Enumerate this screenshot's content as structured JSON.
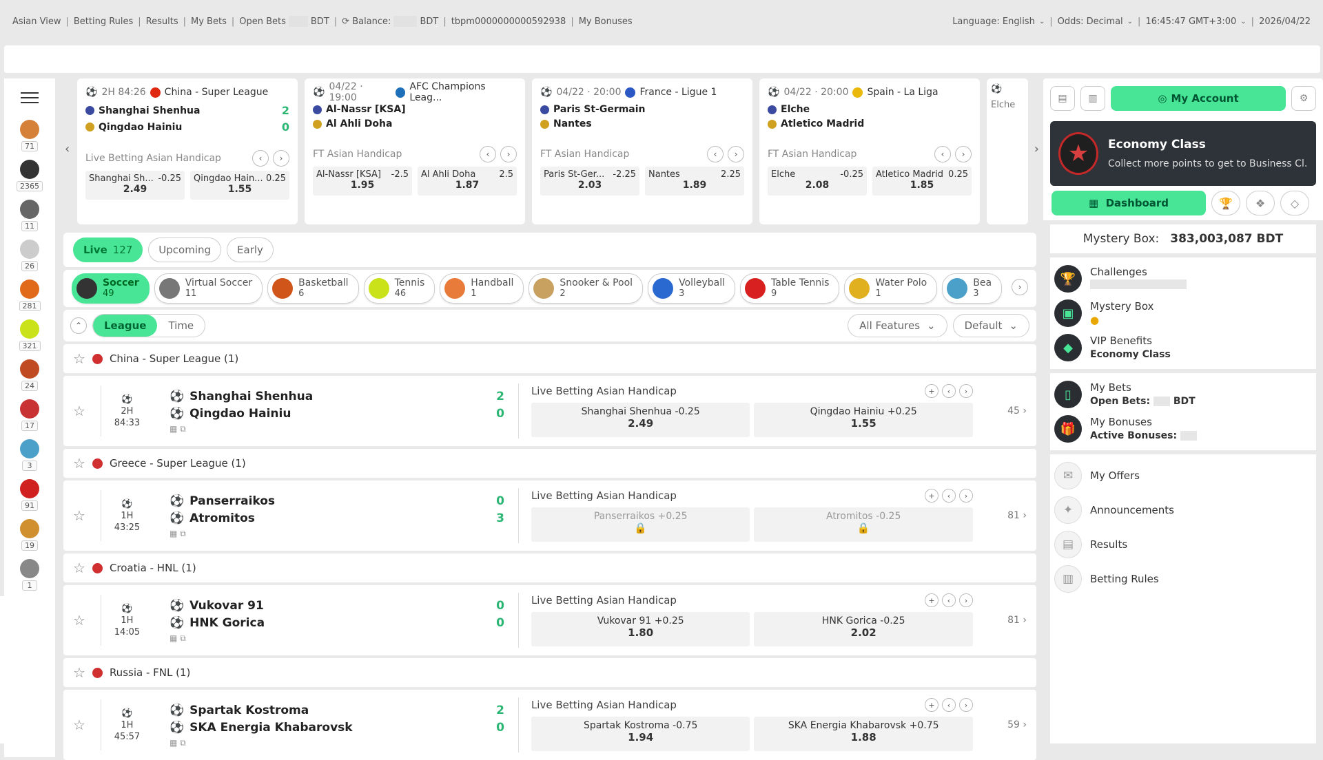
{
  "topbar": {
    "left": [
      "Asian View",
      "Betting Rules",
      "Results",
      "My Bets",
      "Open Bets",
      "BDT",
      "Balance:",
      "BDT",
      "tbpm0000000000592938",
      "My Bonuses"
    ],
    "language_label": "Language:",
    "language": "English",
    "odds_label": "Odds:",
    "odds": "Decimal",
    "time": "16:45:47 GMT+3:00",
    "date": "2026/04/22"
  },
  "leftnav": [
    {
      "c": "71",
      "col": "#d6813a"
    },
    {
      "c": "2365",
      "col": "#333"
    },
    {
      "c": "11",
      "col": "#666"
    },
    {
      "c": "26",
      "col": "#ccc"
    },
    {
      "c": "281",
      "col": "#e06a1a"
    },
    {
      "c": "321",
      "col": "#c9e21a"
    },
    {
      "c": "24",
      "col": "#c04a22"
    },
    {
      "c": "17",
      "col": "#c83232"
    },
    {
      "c": "3",
      "col": "#4aa0c8"
    },
    {
      "c": "91",
      "col": "#d02020"
    },
    {
      "c": "19",
      "col": "#d09030"
    },
    {
      "c": "1",
      "col": "#888"
    }
  ],
  "carousel": [
    {
      "hdr_time": "2H 84:26",
      "league": "China - Super League",
      "flag": "#de2910",
      "home": "Shanghai Shenhua",
      "away": "Qingdao Hainiu",
      "hs": "2",
      "as": "0",
      "market": "Live Betting Asian Handicap",
      "o1n": "Shanghai Sh...",
      "o1h": "-0.25",
      "o1v": "2.49",
      "o2n": "Qingdao Hain...",
      "o2h": "0.25",
      "o2v": "1.55"
    },
    {
      "hdr_time": "04/22 · 19:00",
      "league": "AFC Champions Leag...",
      "flag": "#1c6fb8",
      "home": "Al-Nassr [KSA]",
      "away": "Al Ahli Doha",
      "hs": "",
      "as": "",
      "market": "FT Asian Handicap",
      "o1n": "Al-Nassr [KSA]",
      "o1h": "-2.5",
      "o1v": "1.95",
      "o2n": "Al Ahli Doha",
      "o2h": "2.5",
      "o2v": "1.87"
    },
    {
      "hdr_time": "04/22 · 20:00",
      "league": "France - Ligue 1",
      "flag": "#2a57c4",
      "home": "Paris St-Germain",
      "away": "Nantes",
      "hs": "",
      "as": "",
      "market": "FT Asian Handicap",
      "o1n": "Paris St-Ger...",
      "o1h": "-2.25",
      "o1v": "2.03",
      "o2n": "Nantes",
      "o2h": "2.25",
      "o2v": "1.89"
    },
    {
      "hdr_time": "04/22 · 20:00",
      "league": "Spain - La Liga",
      "flag": "#e9b80b",
      "home": "Elche",
      "away": "Atletico Madrid",
      "hs": "",
      "as": "",
      "market": "FT Asian Handicap",
      "o1n": "Elche",
      "o1h": "-0.25",
      "o1v": "2.08",
      "o2n": "Atletico Madrid",
      "o2h": "0.25",
      "o2v": "1.85"
    }
  ],
  "carousel_partial": "Elche",
  "tabs": {
    "live": "Live",
    "live_count": "127",
    "upcoming": "Upcoming",
    "early": "Early"
  },
  "sports": [
    {
      "n": "Soccer",
      "c": "49",
      "col": "#333"
    },
    {
      "n": "Virtual Soccer",
      "c": "11",
      "col": "#777"
    },
    {
      "n": "Basketball",
      "c": "6",
      "col": "#d0551a"
    },
    {
      "n": "Tennis",
      "c": "46",
      "col": "#c9e21a"
    },
    {
      "n": "Handball",
      "c": "1",
      "col": "#e87a3a"
    },
    {
      "n": "Snooker & Pool",
      "c": "2",
      "col": "#c8a060"
    },
    {
      "n": "Volleyball",
      "c": "3",
      "col": "#2a6ad0"
    },
    {
      "n": "Table Tennis",
      "c": "9",
      "col": "#d82020"
    },
    {
      "n": "Water Polo",
      "c": "1",
      "col": "#e0b020"
    },
    {
      "n": "Bea",
      "c": "3",
      "col": "#4aa0c8"
    }
  ],
  "filter": {
    "league": "League",
    "time": "Time",
    "features": "All Features",
    "sort": "Default"
  },
  "events": [
    {
      "league": "China - Super League (1)",
      "period": "2H",
      "clock": "84:33",
      "home": "Shanghai Shenhua",
      "away": "Qingdao Hainiu",
      "hs": "2",
      "as": "0",
      "market": "Live Betting Asian Handicap",
      "o1": "Shanghai Shenhua  -0.25",
      "v1": "2.49",
      "o2": "Qingdao Hainiu +0.25",
      "v2": "1.55",
      "more": "45",
      "locked": false
    },
    {
      "league": "Greece - Super League (1)",
      "period": "1H",
      "clock": "43:25",
      "home": "Panserraikos",
      "away": "Atromitos",
      "hs": "0",
      "as": "3",
      "market": "Live Betting Asian Handicap",
      "o1": "Panserraikos +0.25",
      "v1": "🔒",
      "o2": "Atromitos  -0.25",
      "v2": "🔒",
      "more": "81",
      "locked": true
    },
    {
      "league": "Croatia - HNL (1)",
      "period": "1H",
      "clock": "14:05",
      "home": "Vukovar 91",
      "away": "HNK Gorica",
      "hs": "0",
      "as": "0",
      "market": "Live Betting Asian Handicap",
      "o1": "Vukovar 91 +0.25",
      "v1": "1.80",
      "o2": "HNK Gorica  -0.25",
      "v2": "2.02",
      "more": "81",
      "locked": false
    },
    {
      "league": "Russia - FNL (1)",
      "period": "1H",
      "clock": "45:57",
      "home": "Spartak Kostroma",
      "away": "SKA Energia Khabarovsk",
      "hs": "2",
      "as": "0",
      "market": "Live Betting Asian Handicap",
      "o1": "Spartak Kostroma  -0.75",
      "v1": "1.94",
      "o2": "SKA Energia Khabarovsk +0.75",
      "v2": "1.88",
      "more": "59",
      "locked": false
    }
  ],
  "right": {
    "my_account": "My Account",
    "vip_title": "Economy Class",
    "vip_sub": "Collect more points to get to Business Cl...",
    "dashboard": "Dashboard",
    "mystery_label": "Mystery Box:",
    "mystery_value": "383,003,087 BDT",
    "challenges": "Challenges",
    "mystery_box": "Mystery Box",
    "vip_benefits": "VIP Benefits",
    "vip_level": "Economy Class",
    "my_bets": "My Bets",
    "open_bets": "Open Bets:",
    "open_bets_unit": "BDT",
    "my_bonuses": "My Bonuses",
    "active_bonuses": "Active Bonuses:",
    "my_offers": "My Offers",
    "announcements": "Announcements",
    "results": "Results",
    "betting_rules": "Betting Rules"
  }
}
